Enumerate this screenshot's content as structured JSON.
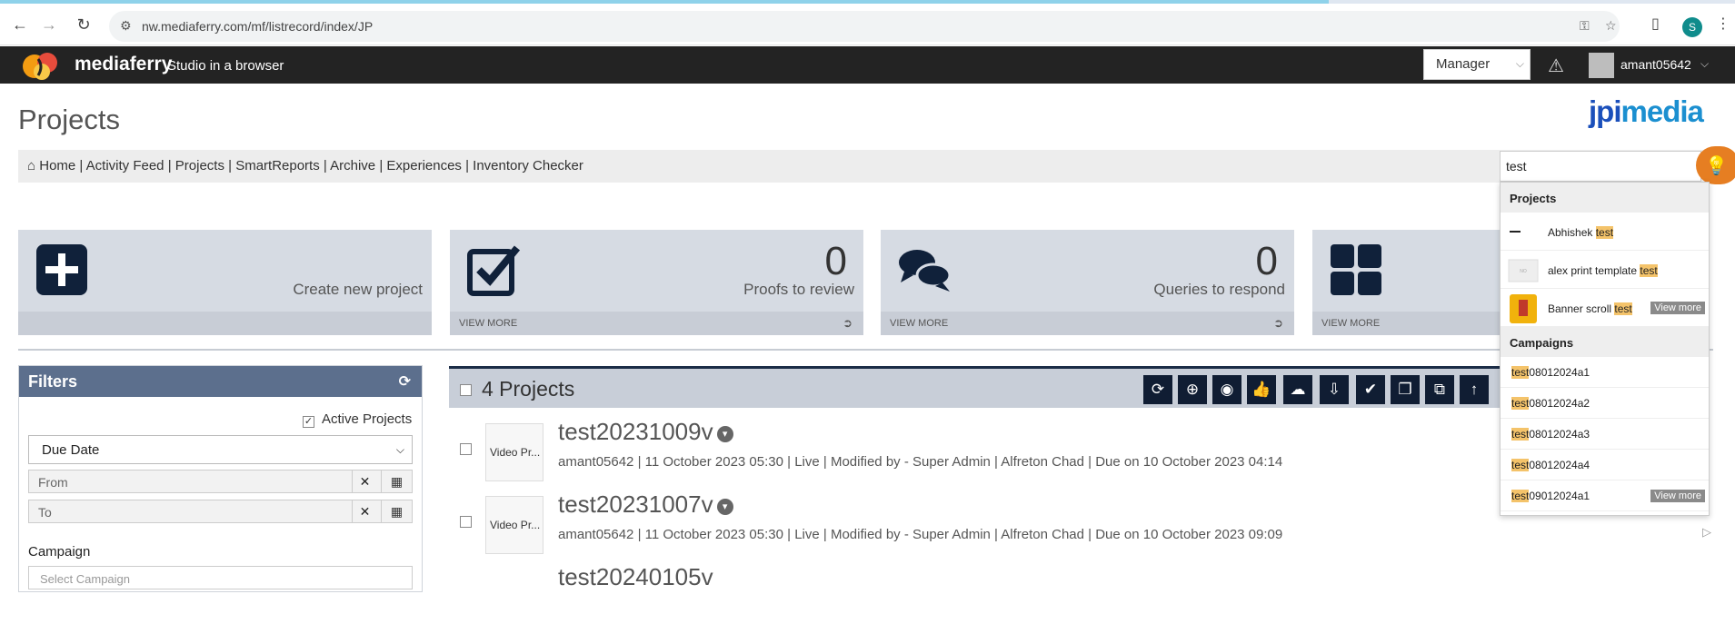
{
  "browser": {
    "url": "nw.mediaferry.com/mf/listrecord/index/JP",
    "profile_initial": "S"
  },
  "app": {
    "brand": "mediaferry",
    "tagline": "Studio in a browser",
    "role": "Manager",
    "username": "amant05642"
  },
  "page": {
    "title": "Projects",
    "client_logo_a": "jpi",
    "client_logo_b": "media"
  },
  "breadcrumbs": [
    "Home",
    "Activity Feed",
    "Projects",
    "SmartReports",
    "Archive",
    "Experiences",
    "Inventory Checker"
  ],
  "search": {
    "value": "test",
    "projects_heading": "Projects",
    "projects": [
      {
        "prefix": "Abhishek ",
        "match": "test",
        "view_more": ""
      },
      {
        "prefix": "alex print template ",
        "match": "test",
        "view_more": ""
      },
      {
        "prefix": "Banner scroll ",
        "match": "test",
        "view_more": "View more"
      }
    ],
    "campaigns_heading": "Campaigns",
    "campaigns": [
      {
        "match": "test",
        "suffix": "08012024a1",
        "view_more": ""
      },
      {
        "match": "test",
        "suffix": "08012024a2",
        "view_more": ""
      },
      {
        "match": "test",
        "suffix": "08012024a3",
        "view_more": ""
      },
      {
        "match": "test",
        "suffix": "08012024a4",
        "view_more": ""
      },
      {
        "match": "test",
        "suffix": "09012024a1",
        "view_more": "View more"
      }
    ]
  },
  "cards": [
    {
      "label": "Create new project"
    },
    {
      "count": "0",
      "label": "Proofs to review",
      "footer": "VIEW MORE"
    },
    {
      "count": "0",
      "label": "Queries to respond",
      "footer": "VIEW MORE"
    },
    {
      "footer": "VIEW MORE"
    }
  ],
  "filters": {
    "title": "Filters",
    "active_label": "Active Projects",
    "date_type": "Due Date",
    "from_placeholder": "From",
    "to_placeholder": "To",
    "campaign_label": "Campaign",
    "campaign_placeholder": "Select Campaign"
  },
  "projects": {
    "count_label": "4 Projects",
    "rows": [
      {
        "thumb": "Video Pr...",
        "name": "test20231009v",
        "meta": "amant05642 | 11 October 2023 05:30 | Live | Modified by - Super Admin | Alfreton Chad | Due on 10 October 2023 04:14"
      },
      {
        "thumb": "Video Pr...",
        "name": "test20231007v",
        "meta": "amant05642 | 11 October 2023 05:30 | Live | Modified by - Super Admin | Alfreton Chad | Due on 10 October 2023 09:09"
      },
      {
        "thumb": "",
        "name": "test20240105v",
        "meta": ""
      }
    ]
  },
  "colors": {
    "header_bg": "#232323",
    "card_bg": "#d6dbe3",
    "icon_dark": "#101d33",
    "highlight": "#f4c36a"
  }
}
